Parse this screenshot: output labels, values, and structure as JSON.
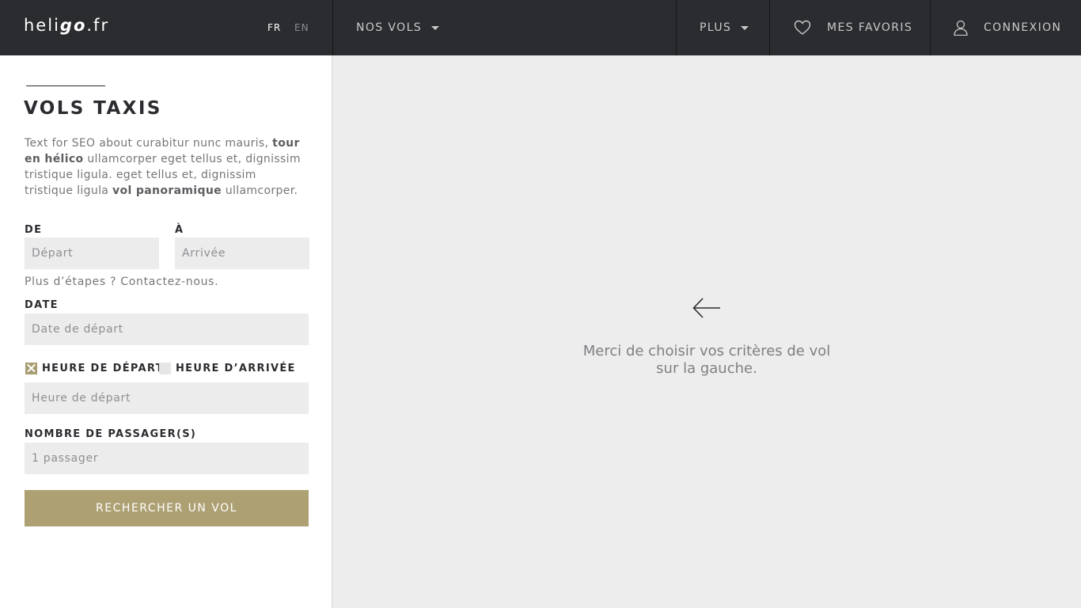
{
  "header": {
    "logo": {
      "prefix": "heli",
      "emphasis": "go",
      "suffix": ".fr"
    },
    "languages": [
      {
        "label": "FR",
        "active": true
      },
      {
        "label": "EN",
        "active": false
      }
    ],
    "nav": {
      "flights": "NOS VOLS",
      "more": "PLUS",
      "favorites": "MES FAVORIS",
      "login": "CONNEXION"
    },
    "icons": {
      "flights_dropdown": "chevron-down-icon",
      "more_dropdown": "chevron-down-icon",
      "favorites": "heart-icon",
      "login": "user-icon"
    }
  },
  "sidebar": {
    "title": "VOLS TAXIS",
    "intro": {
      "t1": "Text for SEO about curabitur nunc mauris, ",
      "b1": "tour en hélico",
      "t2": " ullamcorper eget tellus et, dignissim tristique ligula. eget tellus et, dignissim tristique ligula ",
      "b2": "vol panoramique",
      "t3": " ullamcorper."
    },
    "from": {
      "label": "DE",
      "placeholder": "Départ",
      "value": ""
    },
    "to": {
      "label": "À",
      "placeholder": "Arrivée",
      "value": ""
    },
    "more_steps": "Plus d’étapes ? Contactez-nous.",
    "date": {
      "label": "DATE",
      "placeholder": "Date de départ",
      "value": ""
    },
    "time_mode": {
      "departure_label": "HEURE DE DÉPART",
      "departure_checked": true,
      "arrival_label": "HEURE D’ARRIVÉE",
      "arrival_checked": false
    },
    "time": {
      "placeholder": "Heure de départ",
      "value": ""
    },
    "passengers": {
      "label": "NOMBRE DE PASSAGER(S)",
      "placeholder": "1 passager",
      "value": ""
    },
    "search_button": "RECHERCHER UN VOL"
  },
  "main": {
    "icon": "arrow-left-icon",
    "message_line1": "Merci de choisir vos critères de vol",
    "message_line2": "sur la gauche."
  },
  "colors": {
    "header_bg": "#2b2c30",
    "accent_gold": "#ada073",
    "panel_bg": "#ededed",
    "field_bg": "#ececec",
    "title_text": "#2b2c30"
  }
}
